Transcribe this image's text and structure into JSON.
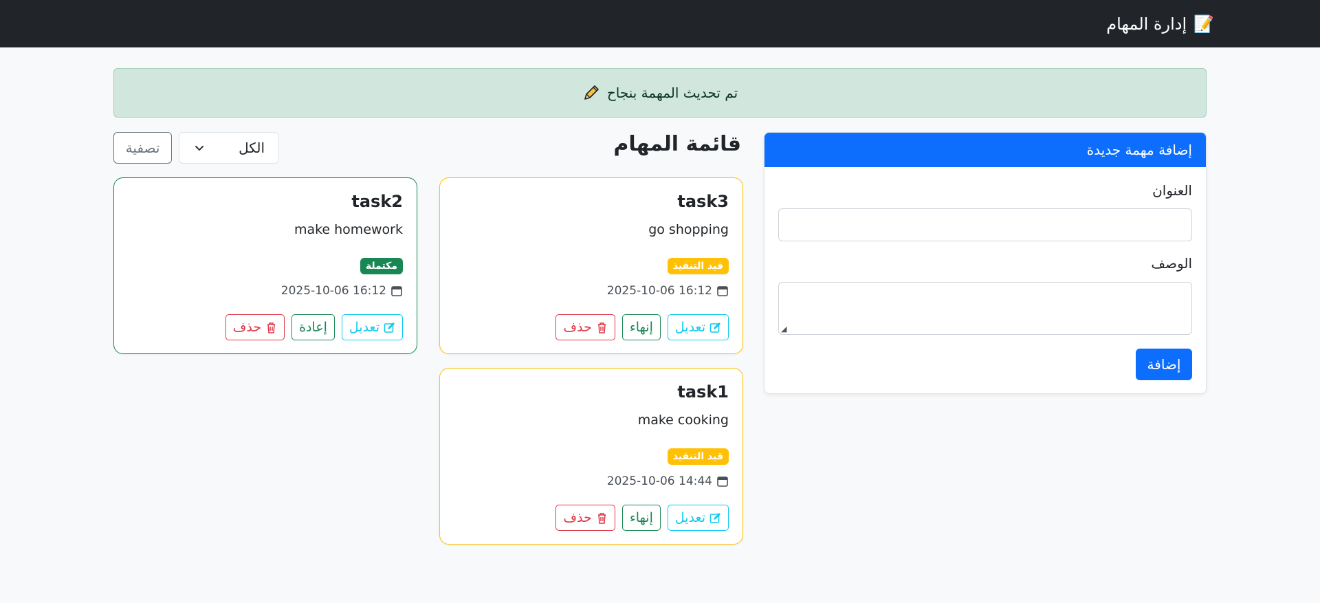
{
  "navbar": {
    "title": "إدارة المهام",
    "icon": "memo-icon"
  },
  "alert": {
    "message": "تم تحديث المهمة بنجاح",
    "icon": "pencil-icon"
  },
  "add_form": {
    "header": "إضافة مهمة جديدة",
    "title_label": "العنوان",
    "title_value": "",
    "description_label": "الوصف",
    "description_value": "",
    "submit_label": "إضافة"
  },
  "list": {
    "title": "قائمة المهام",
    "filter_value": "الكل",
    "filter_button": "تصفية"
  },
  "tasks": [
    {
      "title": "task3",
      "description": "go shopping",
      "status": "قيد التنفيذ",
      "date": "2025-10-06 16:12",
      "edit_label": "تعديل",
      "toggle_label": "إنهاء",
      "delete_label": "حذف"
    },
    {
      "title": "task2",
      "description": "make homework",
      "status": "مكتملة",
      "date": "2025-10-06 16:12",
      "edit_label": "تعديل",
      "toggle_label": "إعادة",
      "delete_label": "حذف"
    },
    {
      "title": "task1",
      "description": "make cooking",
      "status": "قيد التنفيذ",
      "date": "2025-10-06 14:44",
      "edit_label": "تعديل",
      "toggle_label": "إنهاء",
      "delete_label": "حذف"
    }
  ],
  "colors": {
    "navbar": "#212529",
    "primary": "#0d6efd",
    "success": "#198754",
    "warning": "#ffc107",
    "danger": "#dc3545",
    "info": "#0dcaf0"
  }
}
